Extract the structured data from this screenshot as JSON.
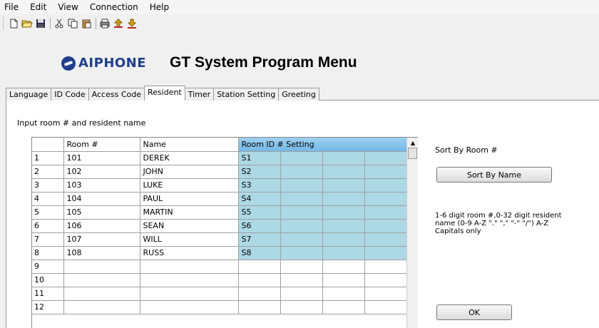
{
  "menu": [
    "File",
    "Edit",
    "View",
    "Connection",
    "Help"
  ],
  "toolbar": [
    "new-doc-icon",
    "open-folder-icon",
    "save-icon",
    "cut-icon",
    "copy-icon",
    "paste-icon",
    "print-icon",
    "upload-icon",
    "download-icon"
  ],
  "header": {
    "logo": "AIPHONE",
    "title": "GT System Program Menu"
  },
  "tabs": [
    "Language",
    "ID Code",
    "Access Code",
    "Resident",
    "Timer",
    "Station Setting",
    "Greeting"
  ],
  "active_tab": "Resident",
  "instruction": "Input room # and resident name",
  "grid": {
    "headers": {
      "num": "",
      "room": "Room #",
      "name": "Name",
      "setting": "Room ID # Setting"
    },
    "rows": [
      {
        "n": "1",
        "room": "101",
        "name": "DEREK",
        "id": "S1"
      },
      {
        "n": "2",
        "room": "102",
        "name": "JOHN",
        "id": "S2"
      },
      {
        "n": "3",
        "room": "103",
        "name": "LUKE",
        "id": "S3"
      },
      {
        "n": "4",
        "room": "104",
        "name": "PAUL",
        "id": "S4"
      },
      {
        "n": "5",
        "room": "105",
        "name": "MARTIN",
        "id": "S5"
      },
      {
        "n": "6",
        "room": "106",
        "name": "SEAN",
        "id": "S6"
      },
      {
        "n": "7",
        "room": "107",
        "name": "WILL",
        "id": "S7"
      },
      {
        "n": "8",
        "room": "108",
        "name": "RUSS",
        "id": "S8"
      },
      {
        "n": "9",
        "room": "",
        "name": "",
        "id": ""
      },
      {
        "n": "10",
        "room": "",
        "name": "",
        "id": ""
      },
      {
        "n": "11",
        "room": "",
        "name": "",
        "id": ""
      },
      {
        "n": "12",
        "room": "",
        "name": "",
        "id": ""
      }
    ]
  },
  "side": {
    "sort_label": "Sort By Room #",
    "sort_button": "Sort By Name",
    "hint": "1-6 digit room #,0-32 digit resident name (0-9 A-Z \".\" \",\" \"-\" \"/\") A-Z Capitals only",
    "ok_button": "OK"
  },
  "colors": {
    "setting_fill": "#add8e6",
    "setting_header": "#74b8e6",
    "logo": "#1f3f8c"
  }
}
